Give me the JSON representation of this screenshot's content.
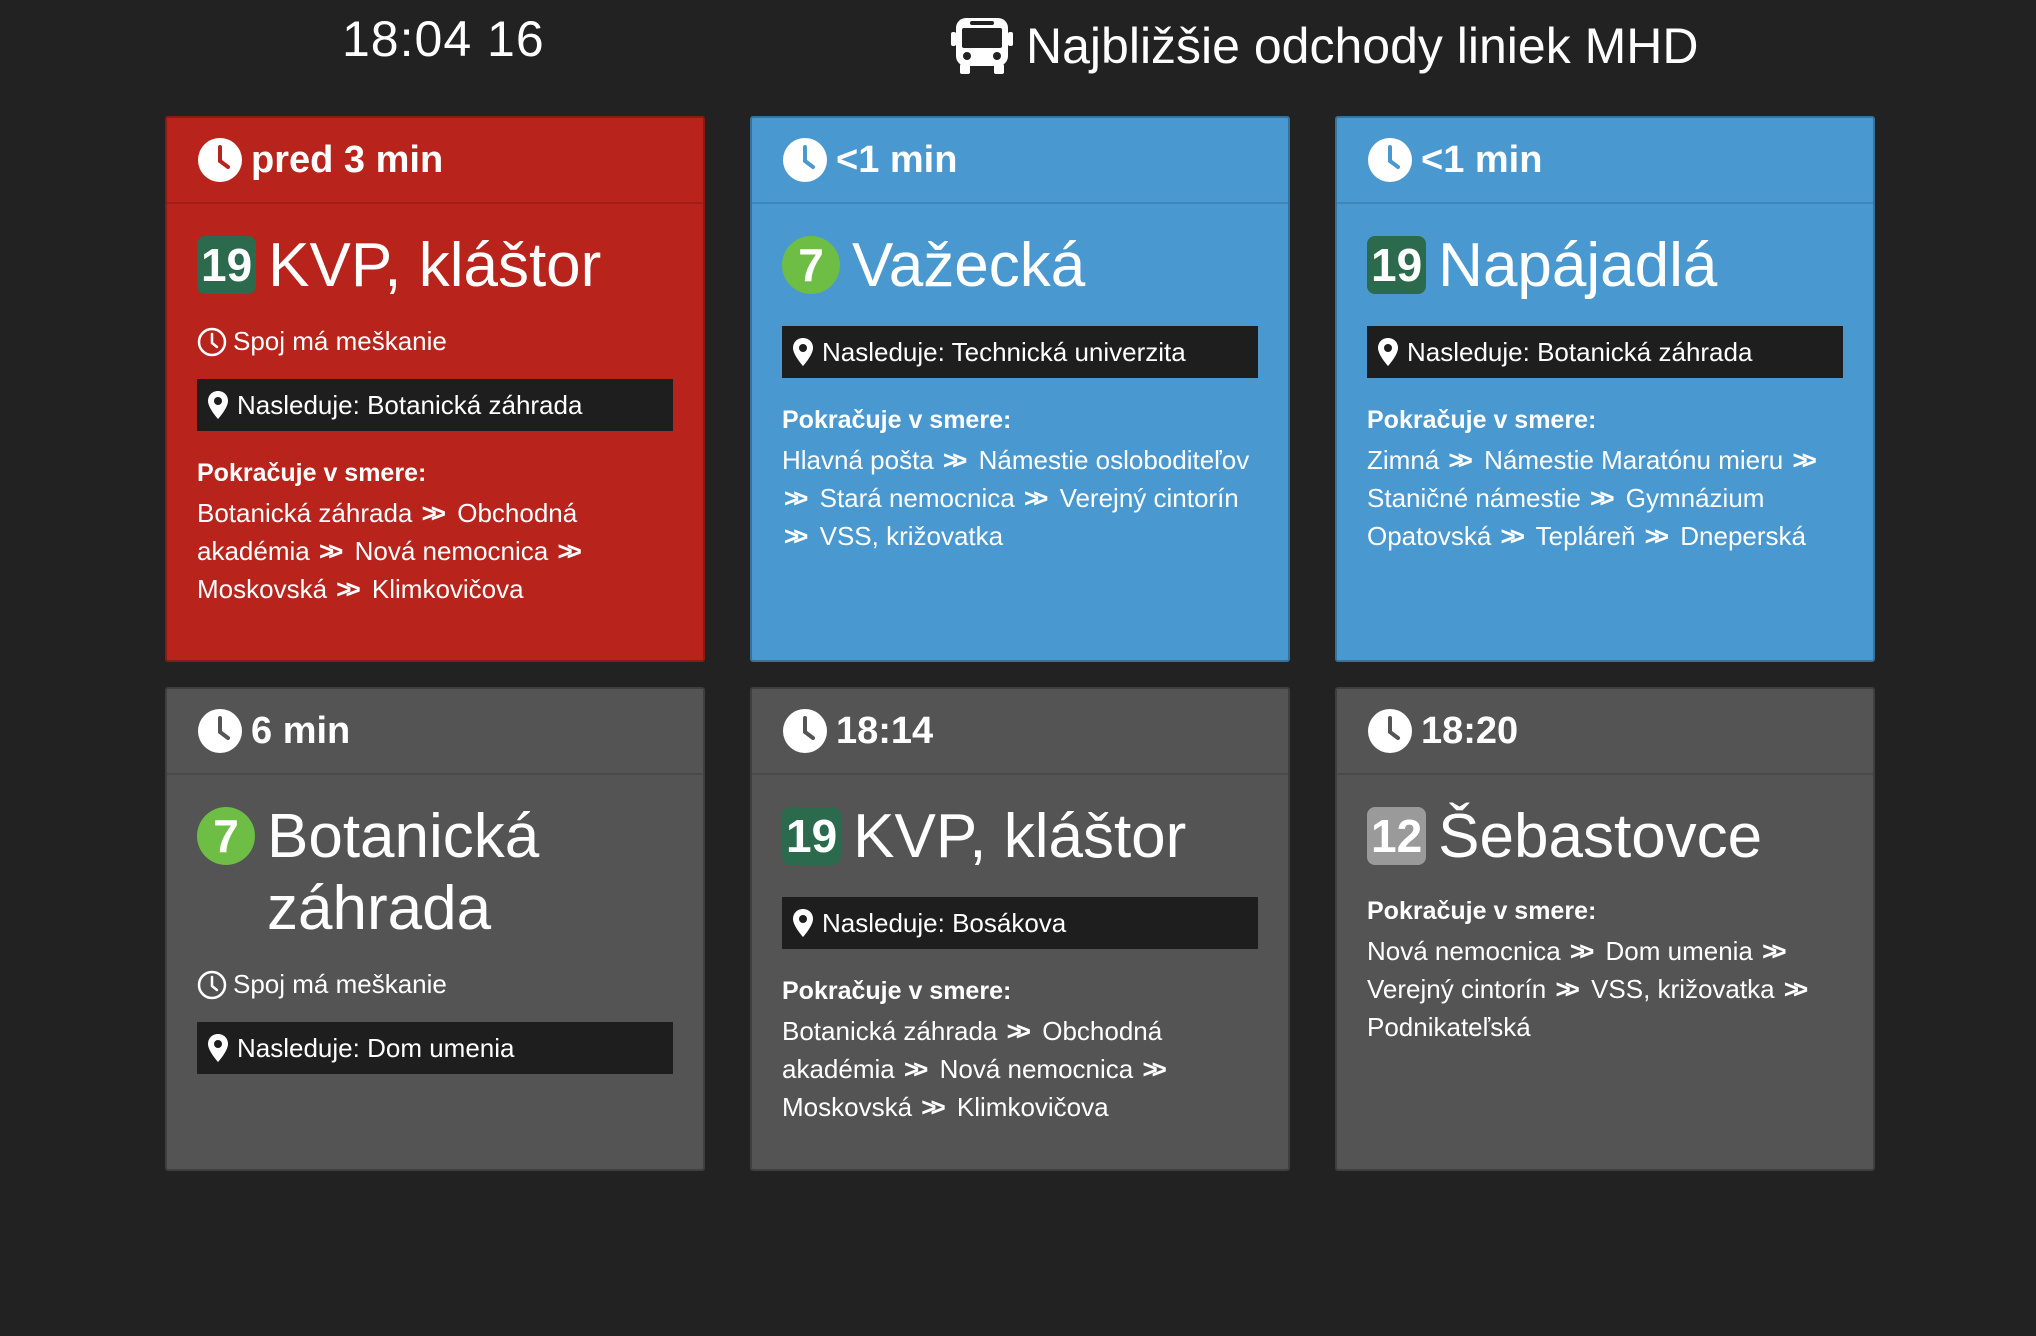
{
  "header": {
    "clock": "18:04 16",
    "title": "Najbližšie odchody liniek MHD"
  },
  "labels": {
    "continues": "Pokračuje v smere:",
    "delay": "Spoj má meškanie"
  },
  "colors": {
    "background": "#222222",
    "late": "#b8231b",
    "now": "#4a98d0",
    "upcoming": "#545454",
    "line19": "#2b6a4d",
    "line7": "#6ebd45",
    "line12": "#9a9a9a",
    "next_bar": "#1e1e1e"
  },
  "departures": [
    {
      "time": "pred 3 min",
      "line": "19",
      "destination": "KVP, kláštor",
      "delay": "Spoj má meškanie",
      "next": "Nasleduje: Botanická záhrada",
      "continues": [
        "Botanická záhrada",
        "Obchodná akadémia",
        "Nová nemocnica",
        "Moskovská",
        "Klimkovičova"
      ]
    },
    {
      "time": "<1 min",
      "line": "7",
      "destination": "Važecká",
      "next": "Nasleduje: Technická univerzita",
      "continues": [
        "Hlavná pošta",
        "Námestie osloboditeľov",
        "Stará nemocnica",
        "Verejný cintorín",
        "VSS, križovatka"
      ]
    },
    {
      "time": "<1 min",
      "line": "19",
      "destination": "Napájadlá",
      "next": "Nasleduje: Botanická záhrada",
      "continues": [
        "Zimná",
        "Námestie Maratónu mieru",
        "Staničné námestie",
        "Gymnázium Opatovská",
        "Tepláreň",
        "Dneperská"
      ]
    },
    {
      "time": "6 min",
      "line": "7",
      "destination": "Botanická záhrada",
      "delay": "Spoj má meškanie",
      "next": "Nasleduje: Dom umenia"
    },
    {
      "time": "18:14",
      "line": "19",
      "destination": "KVP, kláštor",
      "next": "Nasleduje: Bosákova",
      "continues": [
        "Botanická záhrada",
        "Obchodná akadémia",
        "Nová nemocnica",
        "Moskovská",
        "Klimkovičova"
      ]
    },
    {
      "time": "18:20",
      "line": "12",
      "destination": "Šebastovce",
      "continues": [
        "Nová nemocnica",
        "Dom umenia",
        "Verejný cintorín",
        "VSS, križovatka",
        "Podnikateľská"
      ]
    }
  ]
}
